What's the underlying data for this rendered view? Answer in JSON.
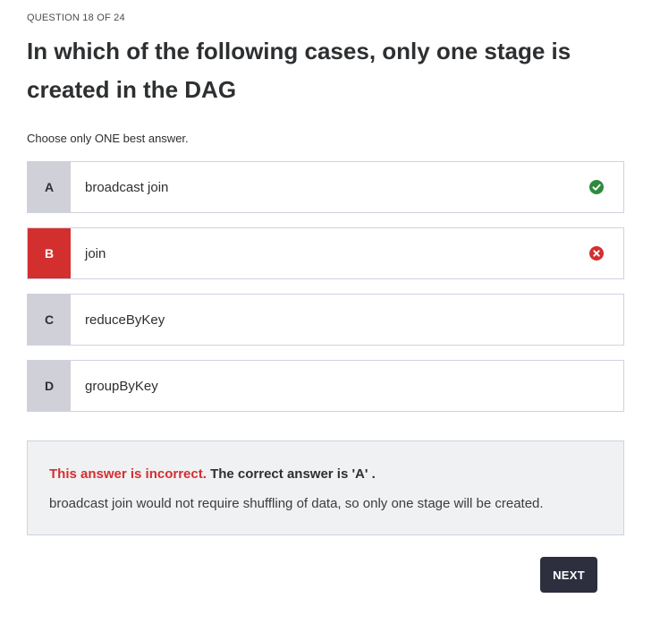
{
  "question": {
    "counter": "QUESTION 18 OF 24",
    "title": "In which of the following cases, only one stage is created in the DAG",
    "instruction": "Choose only ONE best answer."
  },
  "options": [
    {
      "letter": "A",
      "text": "broadcast join",
      "state": "correct",
      "icon": "check-circle-icon"
    },
    {
      "letter": "B",
      "text": "join",
      "state": "selected-incorrect",
      "icon": "x-circle-icon"
    },
    {
      "letter": "C",
      "text": "reduceByKey",
      "state": "neutral"
    },
    {
      "letter": "D",
      "text": "groupByKey",
      "state": "neutral"
    }
  ],
  "feedback": {
    "incorrect_label": "This answer is incorrect.",
    "correct_answer_text": "The correct answer is 'A' .",
    "explanation": "broadcast join would not require shuffling of data, so only one stage will be created."
  },
  "actions": {
    "next_label": "NEXT"
  },
  "colors": {
    "correct_green": "#2e8b3d",
    "incorrect_red": "#d32f2f",
    "letter_bg": "#cfd0d8",
    "button_dark": "#2d2f3f"
  }
}
